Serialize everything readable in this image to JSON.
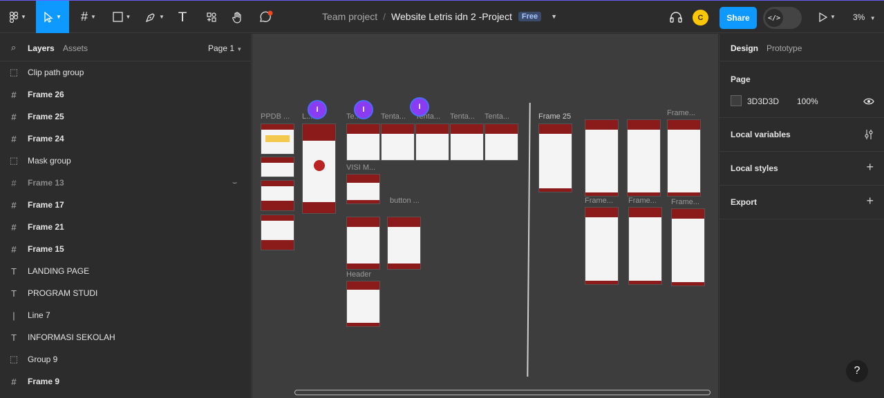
{
  "toolbar": {
    "breadcrumb_team": "Team project",
    "breadcrumb_sep": "/",
    "file_name": "Website Letris idn 2 -Project",
    "plan_badge": "Free",
    "avatar_initial": "C",
    "share_label": "Share",
    "dev_mode_icon": "</>",
    "zoom_label": "3%"
  },
  "left_panel": {
    "tabs": [
      "Layers",
      "Assets"
    ],
    "page_selector": "Page 1",
    "layers": [
      {
        "name": "Clip path group",
        "icon": "group-icon"
      },
      {
        "name": "Frame 26",
        "icon": "frame-icon"
      },
      {
        "name": "Frame 25",
        "icon": "frame-icon"
      },
      {
        "name": "Frame 24",
        "icon": "frame-icon"
      },
      {
        "name": "Mask group",
        "icon": "group-icon"
      },
      {
        "name": "Frame 13",
        "icon": "frame-icon"
      },
      {
        "name": "Frame 17",
        "icon": "frame-icon"
      },
      {
        "name": "Frame 21",
        "icon": "frame-icon"
      },
      {
        "name": "Frame 15",
        "icon": "frame-icon"
      },
      {
        "name": "LANDING PAGE",
        "icon": "text-icon"
      },
      {
        "name": "PROGRAM STUDI",
        "icon": "text-icon"
      },
      {
        "name": "Line 7",
        "icon": "line-icon"
      },
      {
        "name": "INFORMASI SEKOLAH",
        "icon": "text-icon"
      },
      {
        "name": "Group 9",
        "icon": "group-icon"
      },
      {
        "name": "Frame 9",
        "icon": "frame-icon"
      }
    ]
  },
  "canvas": {
    "labels": [
      "PPDB ...",
      "L...",
      "Te...",
      "Tenta...",
      "Tenta...",
      "Tenta...",
      "Tenta...",
      "VISI M...",
      "button ...",
      "Header",
      "Frame 25",
      "Frame...",
      "Frame...",
      "Frame...",
      "Frame..."
    ],
    "cursor_initial": "I"
  },
  "right_panel": {
    "tabs": [
      "Design",
      "Prototype"
    ],
    "page_title": "Page",
    "bg_color_hex": "3D3D3D",
    "bg_opacity": "100%",
    "sections": [
      "Local variables",
      "Local styles",
      "Export"
    ]
  },
  "help_label": "?"
}
